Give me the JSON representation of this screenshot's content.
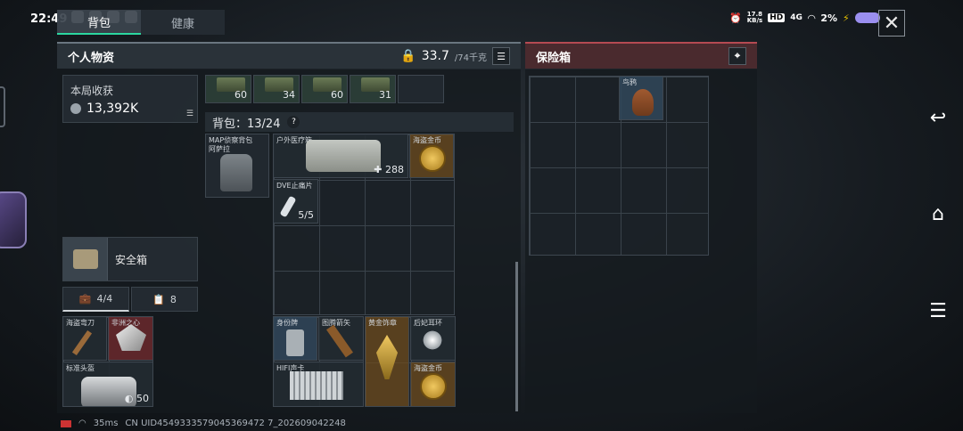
{
  "status": {
    "time": "22:49",
    "right": [
      "17.8\nKB/s",
      "HD",
      "4G",
      "2%"
    ]
  },
  "tabs": [
    {
      "label": "背包",
      "active": true
    },
    {
      "label": "健康",
      "active": false
    }
  ],
  "personal": {
    "title": "个人物资",
    "weight": "33.7",
    "weight_max": "/74千克",
    "earnings_label": "本局收获",
    "earnings_value": "13,392K",
    "safebox_label": "安全箱",
    "mini_tab1": "4/4",
    "mini_tab2": "8"
  },
  "ammo": [
    "60",
    "34",
    "60",
    "31"
  ],
  "bag": {
    "title": "背包：13/24",
    "help": "?",
    "backpack_label": "MAP侦察背包\n阿萨拉",
    "medkit_label": "户外医疗箱",
    "medkit_count": "288",
    "coin_label": "海盗金币",
    "syringe_label": "DVE止痛片",
    "syringe_count": "5/5"
  },
  "safebox_items": {
    "knife": "海盗弯刀",
    "diamond": "非洲之心",
    "helmet": "标准头盔",
    "helmet_count": "50"
  },
  "bottom_items": {
    "tag": "身份牌",
    "arrow": "图腾箭矢",
    "card": "HIFI声卡",
    "badge": "黄金饰章",
    "earring": "后妃耳环",
    "coin2": "海盗金币"
  },
  "safe": {
    "title": "保险箱",
    "bird_label": "鸟鸦"
  },
  "footer": {
    "ping": "35ms",
    "uid": "CN UID4549333579045369472 7_202609042248"
  },
  "colors": {
    "accent": "#2bd6a0",
    "safe_red": "#b54a52"
  }
}
